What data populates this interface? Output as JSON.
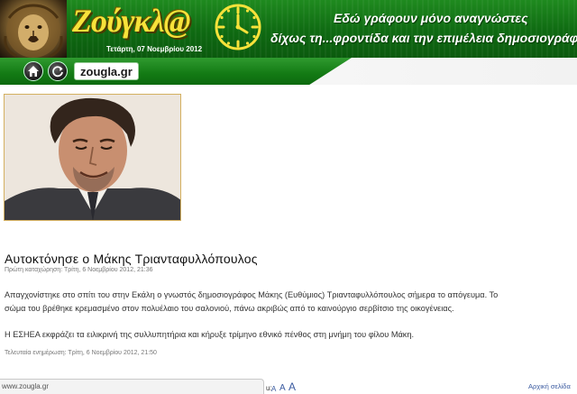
{
  "header": {
    "logo": "Ζούγκλ@",
    "date": "Τετάρτη, 07 Νοεμβρίου 2012",
    "slogan_line1": "Εδώ γράφουν μόνο αναγνώστες",
    "slogan_line2": "δίχως τη...φροντίδα και την επιμέλεια δημοσιογράφων",
    "colors": {
      "banner_green": "#137a14",
      "logo_yellow": "#f7e23a"
    }
  },
  "nav": {
    "home_icon": "home-icon",
    "refresh_icon": "refresh-icon",
    "site_label": "zougla.gr"
  },
  "article": {
    "photo_icon": "portrait-photo",
    "headline": "Αυτοκτόνησε ο Μάκης Τριανταφυλλόπουλος",
    "first_post": "Πρώτη καταχώρηση: Τρίτη, 6 Νοεμβρίου 2012, 21:36",
    "paragraph1_line1": "Απαγχονίστηκε στο σπίτι του στην Εκάλη ο γνωστός δημοσιογράφος Μάκης (Ευθύμιος) Τριανταφυλλόπουλος σήμερα το απόγευμα. Το",
    "paragraph1_line2": "σώμα του βρέθηκε κρεμασμένο στον πολυέλαιο του σαλονιού, πάνω ακριβώς από το καινούργιο σερβίτσιο της οικογένειας.",
    "paragraph2": "Η ΕΣΗΕΑ εκφράζει τα ειλικρινή της συλλυπητήρια και κήρυξε τρίμηνο εθνικό πένθος στη μνήμη του φίλου Μάκη.",
    "last_update": "Τελευταία ενημέρωση: Τρίτη, 6 Νοεμβρίου 2012, 21:50"
  },
  "footer": {
    "status_url": "www.zougla.gr",
    "font_size_label_fragment": "u:",
    "font_small": "A",
    "font_medium": "A",
    "font_large": "A",
    "home_link": "Αρχική σελίδα"
  }
}
